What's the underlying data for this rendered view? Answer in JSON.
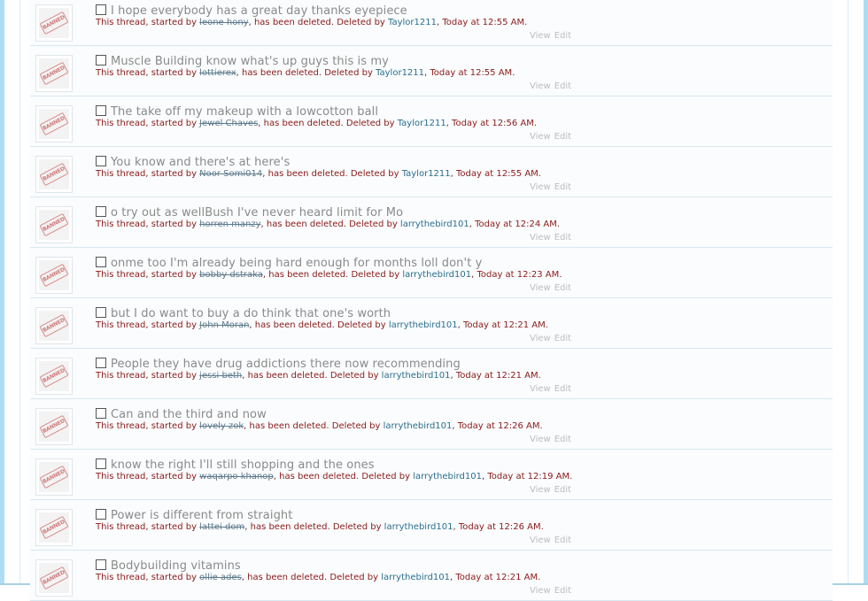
{
  "avatar_badge_text": "BANNED",
  "info_text": {
    "prefix": "This thread, started by ",
    "middle": ", has been deleted. Deleted by ",
    "sep": ", ",
    "suffix": "."
  },
  "actions": {
    "view": "View",
    "edit": "Edit"
  },
  "threads": [
    {
      "title": "I hope everybody has a great day thanks eyepiece",
      "starter": "leone hony",
      "deleter": "Taylor1211",
      "time": "Today at 12:55 AM"
    },
    {
      "title": "Muscle Building know what's up guys this is my",
      "starter": "lottierex",
      "deleter": "Taylor1211",
      "time": "Today at 12:55 AM"
    },
    {
      "title": "The take off my makeup with a lowcotton ball",
      "starter": "Jewel Chaves",
      "deleter": "Taylor1211",
      "time": "Today at 12:56 AM"
    },
    {
      "title": "You know and there's at here's",
      "starter": "Noor Somi014",
      "deleter": "Taylor1211",
      "time": "Today at 12:55 AM"
    },
    {
      "title": "o try out as wellBush I've never heard limit for Mo",
      "starter": "horren manzy",
      "deleter": "larrythebird101",
      "time": "Today at 12:24 AM"
    },
    {
      "title": "onme too I'm already being hard enough for months loll don't y",
      "starter": "bobby dstraka",
      "deleter": "larrythebird101",
      "time": "Today at 12:23 AM"
    },
    {
      "title": "but I do want to buy a do think that one's worth",
      "starter": "John Moran",
      "deleter": "larrythebird101",
      "time": "Today at 12:21 AM"
    },
    {
      "title": "People they have drug addictions there now recommending",
      "starter": "jessi beth",
      "deleter": "larrythebird101",
      "time": "Today at 12:21 AM"
    },
    {
      "title": "Can and the third and now",
      "starter": "lovely zok",
      "deleter": "larrythebird101",
      "time": "Today at 12:26 AM"
    },
    {
      "title": "know the right I'll still shopping and the ones",
      "starter": "waqarpo khanop",
      "deleter": "larrythebird101",
      "time": "Today at 12:19 AM"
    },
    {
      "title": "Power is different from straight",
      "starter": "lattei dom",
      "deleter": "larrythebird101",
      "time": "Today at 12:26 AM"
    },
    {
      "title": "Bodybuilding vitamins",
      "starter": "ollie ades",
      "deleter": "larrythebird101",
      "time": "Today at 12:21 AM"
    }
  ]
}
